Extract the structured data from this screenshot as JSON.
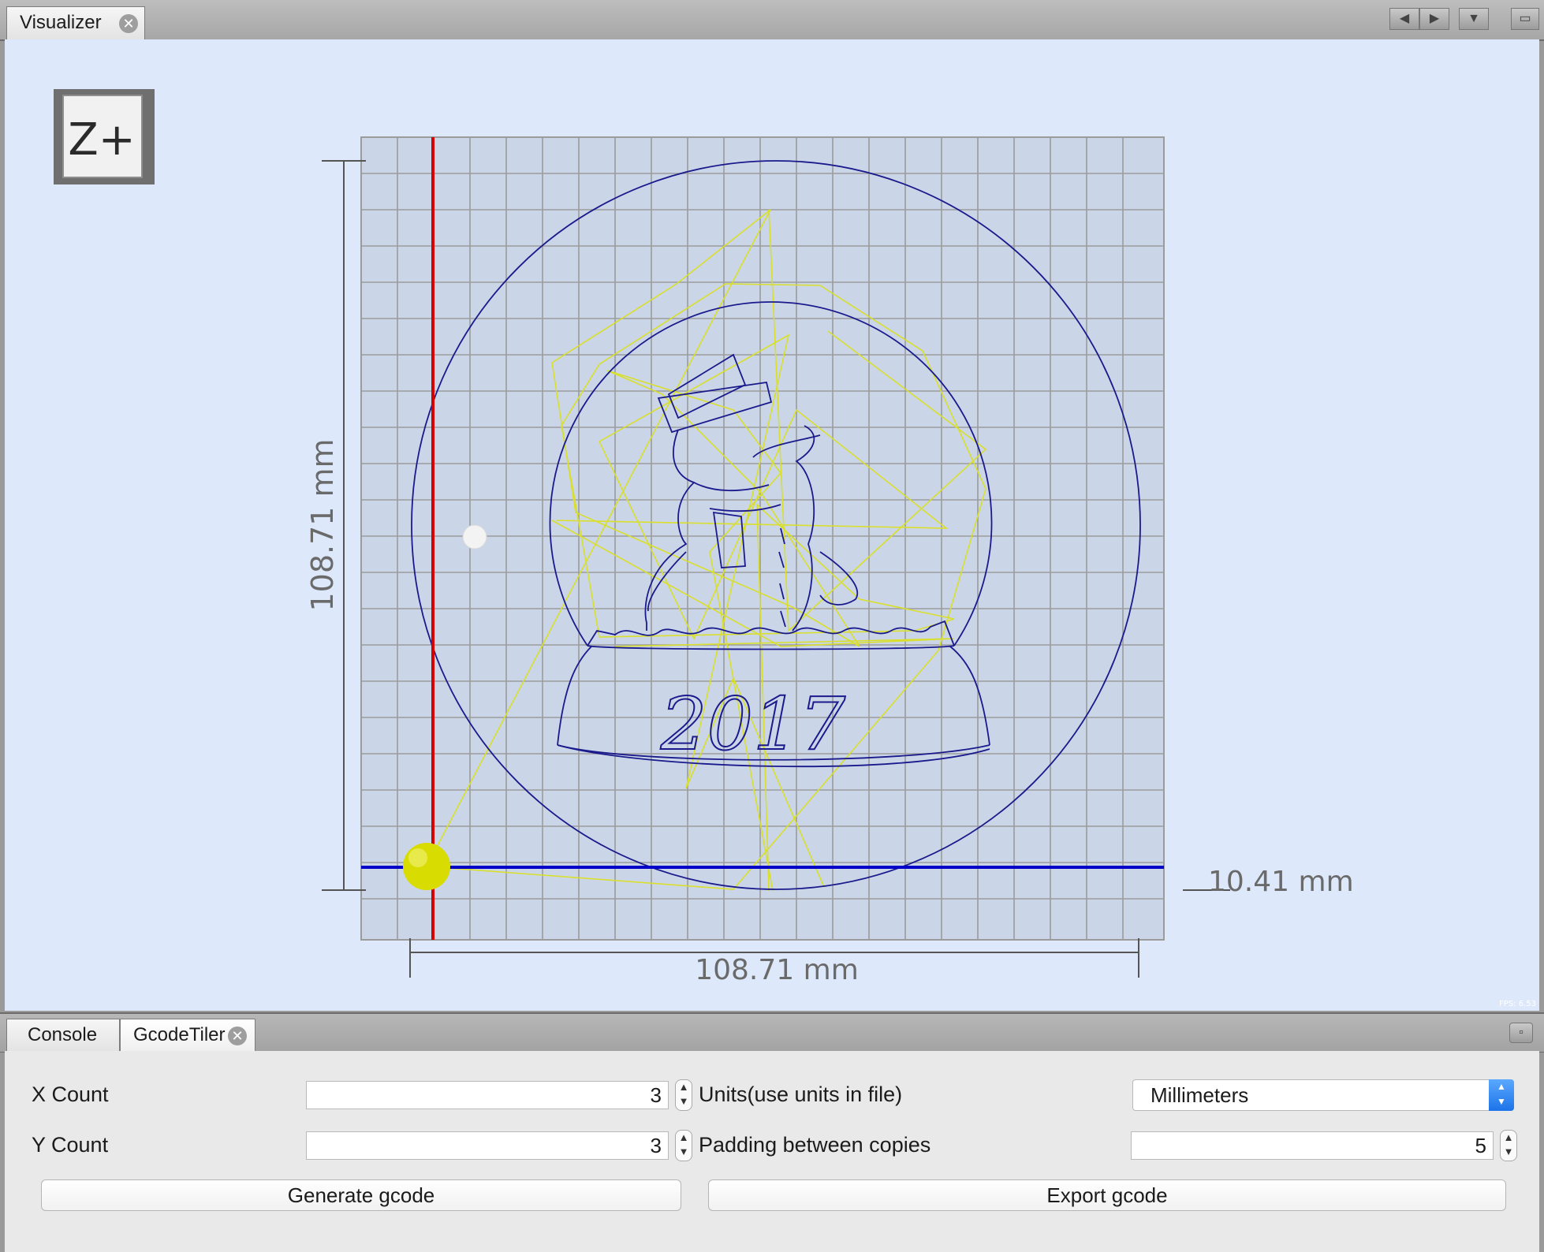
{
  "top_tabs": [
    {
      "label": "Visualizer"
    }
  ],
  "visualizer": {
    "view_cube_label": "Z+",
    "dim_left": "108.71 mm",
    "dim_bottom": "108.71 mm",
    "dim_right": "10.41 mm",
    "design_text": "2017",
    "fps": "FPS: 6.53",
    "colors": {
      "background": "#dde9fb",
      "grid_fill": "#cad6e8",
      "grid_line": "#9b9b9b",
      "x_axis": "#d40000",
      "y_axis": "#0000c8",
      "toolpath": "#1a1a8c",
      "rapid_moves": "#d9df2a",
      "tool": "#d8dc00"
    }
  },
  "bottom_tabs": [
    {
      "label": "Console"
    },
    {
      "label": "GcodeTiler"
    }
  ],
  "gcode_tiler": {
    "x_count_label": "X Count",
    "x_count_value": "3",
    "y_count_label": "Y Count",
    "y_count_value": "3",
    "units_label": "Units(use units in file)",
    "units_value": "Millimeters",
    "padding_label": "Padding between copies",
    "padding_value": "5",
    "generate_label": "Generate gcode",
    "export_label": "Export gcode"
  }
}
